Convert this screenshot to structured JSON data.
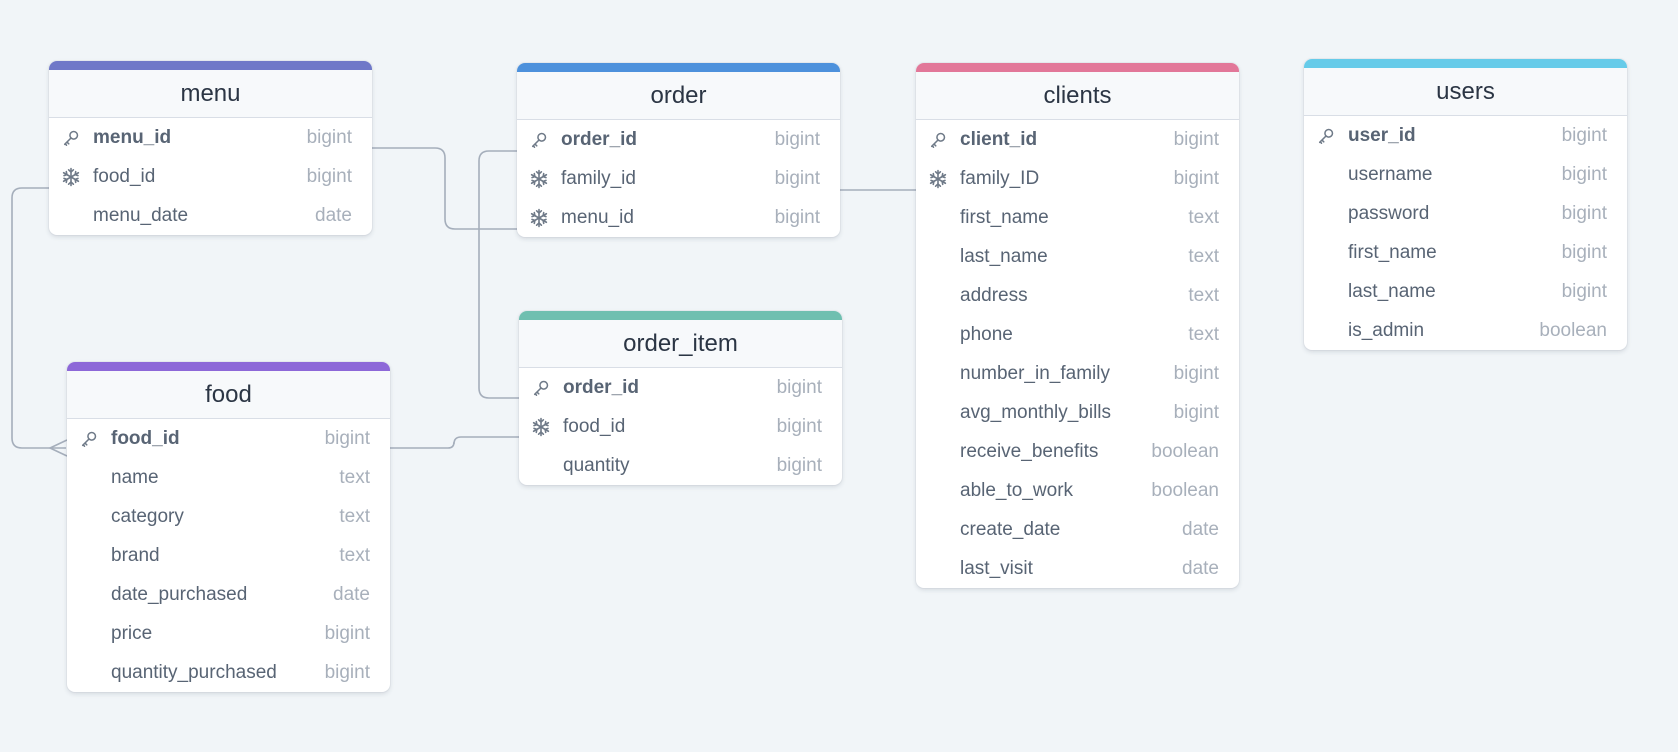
{
  "diagram": {
    "colors": {
      "background": "#f1f5f8",
      "connector": "#a5aebb",
      "menu": "#6f78c8",
      "order": "#4d91dc",
      "clients": "#e27799",
      "users": "#66cbe9",
      "food": "#8d68d8",
      "order_item": "#6fbfb0"
    },
    "tables": [
      {
        "id": "menu",
        "name": "menu",
        "fields": [
          {
            "name": "menu_id",
            "type": "bigint",
            "icon": "key-icon",
            "pk": true
          },
          {
            "name": "food_id",
            "type": "bigint",
            "icon": "snowflake-icon",
            "pk": false
          },
          {
            "name": "menu_date",
            "type": "date",
            "icon": "",
            "pk": false
          }
        ]
      },
      {
        "id": "order",
        "name": "order",
        "fields": [
          {
            "name": "order_id",
            "type": "bigint",
            "icon": "key-icon",
            "pk": true
          },
          {
            "name": "family_id",
            "type": "bigint",
            "icon": "snowflake-icon",
            "pk": false
          },
          {
            "name": "menu_id",
            "type": "bigint",
            "icon": "snowflake-icon",
            "pk": false
          }
        ]
      },
      {
        "id": "clients",
        "name": "clients",
        "fields": [
          {
            "name": "client_id",
            "type": "bigint",
            "icon": "key-icon",
            "pk": true
          },
          {
            "name": "family_ID",
            "type": "bigint",
            "icon": "snowflake-icon",
            "pk": false
          },
          {
            "name": "first_name",
            "type": "text",
            "icon": "",
            "pk": false
          },
          {
            "name": "last_name",
            "type": "text",
            "icon": "",
            "pk": false
          },
          {
            "name": "address",
            "type": "text",
            "icon": "",
            "pk": false
          },
          {
            "name": "phone",
            "type": "text",
            "icon": "",
            "pk": false
          },
          {
            "name": "number_in_family",
            "type": "bigint",
            "icon": "",
            "pk": false
          },
          {
            "name": "avg_monthly_bills",
            "type": "bigint",
            "icon": "",
            "pk": false
          },
          {
            "name": "receive_benefits",
            "type": "boolean",
            "icon": "",
            "pk": false
          },
          {
            "name": "able_to_work",
            "type": "boolean",
            "icon": "",
            "pk": false
          },
          {
            "name": "create_date",
            "type": "date",
            "icon": "",
            "pk": false
          },
          {
            "name": "last_visit",
            "type": "date",
            "icon": "",
            "pk": false
          }
        ]
      },
      {
        "id": "users",
        "name": "users",
        "fields": [
          {
            "name": "user_id",
            "type": "bigint",
            "icon": "key-icon",
            "pk": true
          },
          {
            "name": "username",
            "type": "bigint",
            "icon": "",
            "pk": false
          },
          {
            "name": "password",
            "type": "bigint",
            "icon": "",
            "pk": false
          },
          {
            "name": "first_name",
            "type": "bigint",
            "icon": "",
            "pk": false
          },
          {
            "name": "last_name",
            "type": "bigint",
            "icon": "",
            "pk": false
          },
          {
            "name": "is_admin",
            "type": "boolean",
            "icon": "",
            "pk": false
          }
        ]
      },
      {
        "id": "food",
        "name": "food",
        "fields": [
          {
            "name": "food_id",
            "type": "bigint",
            "icon": "key-icon",
            "pk": true
          },
          {
            "name": "name",
            "type": "text",
            "icon": "",
            "pk": false
          },
          {
            "name": "category",
            "type": "text",
            "icon": "",
            "pk": false
          },
          {
            "name": "brand",
            "type": "text",
            "icon": "",
            "pk": false
          },
          {
            "name": "date_purchased",
            "type": "date",
            "icon": "",
            "pk": false
          },
          {
            "name": "price",
            "type": "bigint",
            "icon": "",
            "pk": false
          },
          {
            "name": "quantity_purchased",
            "type": "bigint",
            "icon": "",
            "pk": false
          }
        ]
      },
      {
        "id": "order_item",
        "name": "order_item",
        "fields": [
          {
            "name": "order_id",
            "type": "bigint",
            "icon": "key-icon",
            "pk": true
          },
          {
            "name": "food_id",
            "type": "bigint",
            "icon": "snowflake-icon",
            "pk": false
          },
          {
            "name": "quantity",
            "type": "bigint",
            "icon": "",
            "pk": false
          }
        ]
      }
    ],
    "relationships": [
      {
        "from": "menu.menu_id",
        "to": "order.menu_id"
      },
      {
        "from": "menu.food_id",
        "to": "food.food_id"
      },
      {
        "from": "order.order_id",
        "to": "order_item.order_id"
      },
      {
        "from": "order.family_id",
        "to": "clients.family_ID"
      },
      {
        "from": "food.food_id",
        "to": "order_item.food_id"
      }
    ]
  }
}
